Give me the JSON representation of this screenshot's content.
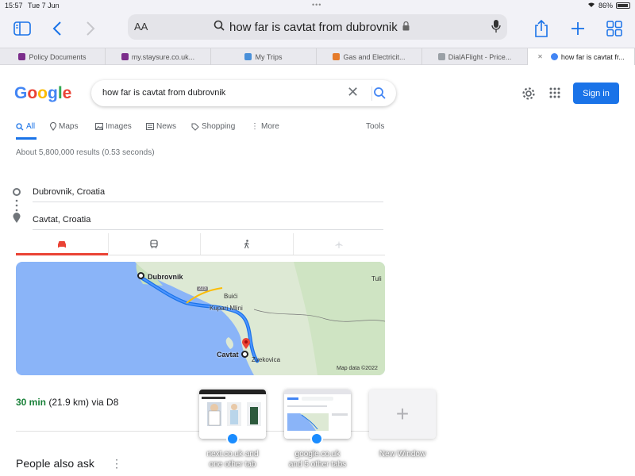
{
  "status": {
    "time": "15:57",
    "date": "Tue 7 Jun",
    "battery": "86%"
  },
  "address_bar": {
    "aa": "AA",
    "query": "how far is cavtat from dubrovnik"
  },
  "tabs": [
    {
      "label": "Policy Documents",
      "color": "#7b2d8b"
    },
    {
      "label": "my.staysure.co.uk...",
      "color": "#7b2d8b"
    },
    {
      "label": "My Trips",
      "color": "#4a90d9"
    },
    {
      "label": "Gas and Electricit...",
      "color": "#e57b2b"
    },
    {
      "label": "DialAFlight - Price...",
      "color": "#9aa0a6"
    },
    {
      "label": "how far is cavtat fr...",
      "color": "#4285f4",
      "active": true
    }
  ],
  "google": {
    "logo_letters": [
      "G",
      "o",
      "o",
      "g",
      "l",
      "e"
    ],
    "search_value": "how far is cavtat from dubrovnik",
    "sign_in": "Sign in",
    "nav": [
      "All",
      "Maps",
      "Images",
      "News",
      "Shopping",
      "More",
      "Tools"
    ],
    "stats": "About 5,800,000 results (0.53 seconds)",
    "from": "Dubrovnik, Croatia",
    "to": "Cavtat, Croatia",
    "map": {
      "labels": {
        "dubrovnik": "Dubrovnik",
        "cavtat": "Cavtat",
        "tuli": "Tuli",
        "buici": "Buići",
        "kupari": "Kupari Mlini",
        "zvekovica": "Zvekovica",
        "road": "223",
        "credit": "Map data ©2022"
      }
    },
    "duration": "30 min",
    "distance": "(21.9 km) via D8",
    "people_also_ask": "People also ask"
  },
  "switcher": {
    "tab1_label_line1": "next.co.uk and",
    "tab1_label_line2": "one other tab",
    "tab2_label_line1": "google.co.uk",
    "tab2_label_line2": "and 5 other tabs",
    "new_window": "New Window"
  },
  "colors": {
    "google_blue": "#1a73e8",
    "route_green": "#188038",
    "map_sea": "#8ab4f8",
    "map_land": "#dde9d4"
  }
}
